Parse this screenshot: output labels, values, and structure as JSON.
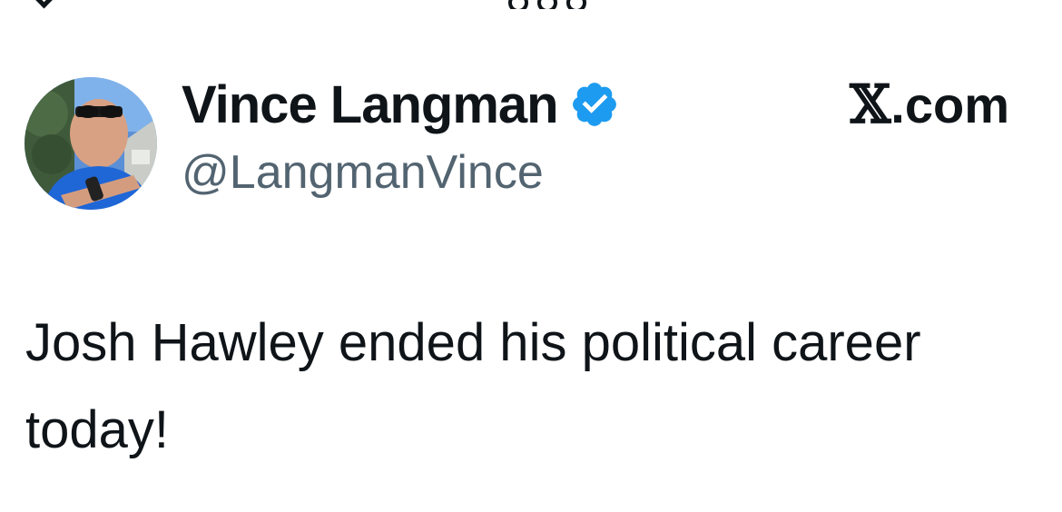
{
  "author": {
    "display_name": "Vince Langman",
    "handle": "@LangmanVince",
    "verified": true,
    "verified_color": "#1d9bf0",
    "avatar_icon": "profile-photo"
  },
  "brand": {
    "symbol": "𝕏",
    "suffix": ".com"
  },
  "tweet": {
    "text": "Josh Hawley ended his political career today!"
  },
  "colors": {
    "text_primary": "#0f1419",
    "text_secondary": "#536471",
    "background": "#ffffff"
  }
}
